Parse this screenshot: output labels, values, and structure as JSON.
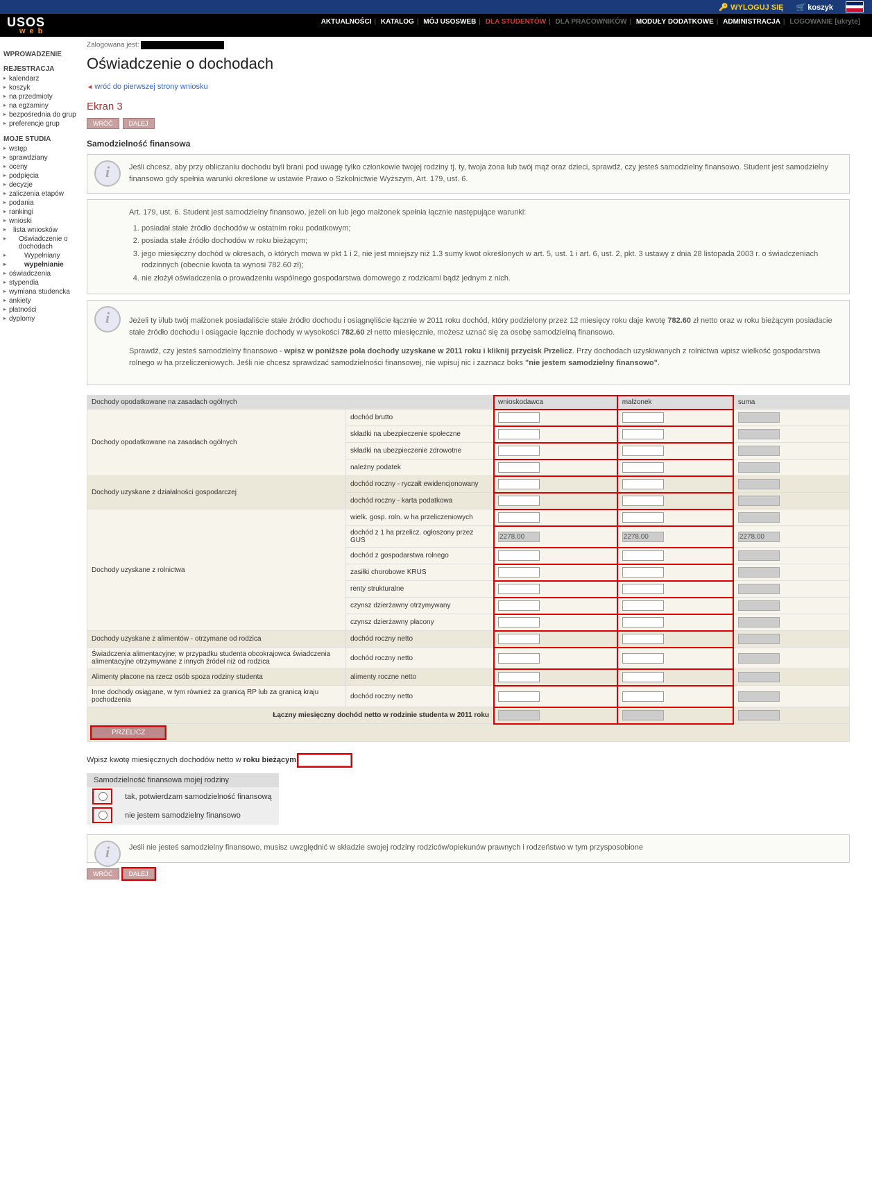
{
  "top": {
    "logout": "WYLOGUJ SIĘ",
    "cart": "koszyk"
  },
  "nav": {
    "items": [
      "AKTUALNOŚCI",
      "KATALOG",
      "MÓJ USOSWEB",
      "DLA STUDENTÓW",
      "DLA PRACOWNIKÓW",
      "MODUŁY DODATKOWE",
      "ADMINISTRACJA",
      "LOGOWANIE [ukryte]"
    ]
  },
  "logged_label": "Zalogowana jest:",
  "sidebar": {
    "s1": {
      "title": "WPROWADZENIE"
    },
    "s2": {
      "title": "REJESTRACJA",
      "items": [
        "kalendarz",
        "koszyk",
        "na przedmioty",
        "na egzaminy",
        "bezpośrednia do grup",
        "preferencje grup"
      ]
    },
    "s3": {
      "title": "MOJE STUDIA",
      "items": [
        "wstęp",
        "sprawdziany",
        "oceny",
        "podpięcia",
        "decyzje",
        "zaliczenia etapów",
        "podania",
        "rankingi",
        "wnioski"
      ],
      "sub": {
        "lista": "lista wniosków",
        "osw": "Oświadczenie o dochodach",
        "wyp": "Wypełniany",
        "wypel": "wypełnianie"
      },
      "rest": [
        "oświadczenia",
        "stypendia",
        "wymiana studencka",
        "ankiety",
        "płatności",
        "dyplomy"
      ]
    }
  },
  "page": {
    "title": "Oświadczenie o dochodach",
    "back": "wróć do pierwszej strony wniosku",
    "screen": "Ekran 3",
    "btn_back": "WRÓĆ",
    "btn_next": "DALEJ",
    "section": "Samodzielność finansowa"
  },
  "info1": "Jeśli chcesz, aby przy obliczaniu dochodu byli brani pod uwagę tylko członkowie twojej rodziny tj. ty, twoja żona lub twój mąż oraz dzieci, sprawdź, czy jesteś samodzielny finansowo. Student jest samodzielny finansowo gdy spełnia warunki określone w ustawie Prawo o Szkolnictwie Wyższym, Art. 179, ust. 6.",
  "info2": {
    "head": "Art. 179, ust. 6. Student jest samodzielny finansowo, jeżeli on lub jego małżonek spełnia łącznie następujące warunki:",
    "items": [
      "posiadał stałe źródło dochodów w ostatnim roku podatkowym;",
      "posiada stałe źródło dochodów w roku bieżącym;",
      "jego miesięczny dochód w okresach, o których mowa w pkt 1 i 2, nie jest mniejszy niż 1.3 sumy kwot określonych w art. 5, ust. 1 i art. 6, ust. 2, pkt. 3 ustawy z dnia 28 listopada 2003 r. o świadczeniach rodzinnych (obecnie kwota ta wynosi 782.60 zł);",
      "nie złożył oświadczenia o prowadzeniu wspólnego gospodarstwa domowego z rodzicami bądź jednym z nich."
    ]
  },
  "info3": {
    "p1a": "Jeżeli ty i/lub twój małżonek posiadaliście stałe źródło dochodu i osiągnęliście łącznie w 2011 roku dochód, który podzielony przez 12 miesięcy roku daje kwotę ",
    "b1": "782.60",
    "p1b": " zł netto oraz w roku bieżącym posiadacie stałe źródło dochodu i osiągacie łącznie dochody w wysokości ",
    "b2": "782.60",
    "p1c": " zł netto miesięcznie, możesz uznać się za osobę samodzielną finansowo.",
    "p2a": "Sprawdź, czy jesteś samodzielny finansowo - ",
    "b3": "wpisz w poniższe pola dochody uzyskane w 2011 roku i kliknij przycisk Przelicz",
    "p2b": ". Przy dochodach uzyskiwanych z rolnictwa wpisz wielkość gospodarstwa rolnego w ha przeliczeniowych. Jeśli nie chcesz sprawdzać samodzielności finansowej, nie wpisuj nic i zaznacz boks ",
    "b4": "\"nie jestem samodzielny finansowo\"",
    "p2c": "."
  },
  "table": {
    "head": {
      "c1": "Dochody opodatkowane na zasadach ogólnych",
      "c2": "",
      "w": "wnioskodawca",
      "m": "małżonek",
      "s": "suma"
    },
    "groups": [
      {
        "label": "Dochody opodatkowane na zasadach ogólnych",
        "rows": [
          {
            "l": "dochód brutto"
          },
          {
            "l": "składki na ubezpieczenie społeczne"
          },
          {
            "l": "składki na ubezpieczenie zdrowotne"
          },
          {
            "l": "należny podatek"
          }
        ],
        "cls": "w"
      },
      {
        "label": "Dochody uzyskane z działalności gospodarczej",
        "rows": [
          {
            "l": "dochód roczny - ryczałt ewidencjonowany"
          },
          {
            "l": "dochód roczny - karta podatkowa"
          }
        ],
        "cls": "g"
      },
      {
        "label": "Dochody uzyskane z rolnictwa",
        "rows": [
          {
            "l": "wielk. gosp. roln. w ha przeliczeniowych"
          },
          {
            "l": "dochód z 1 ha przelicz. ogłoszony przez GUS",
            "ro": true,
            "v": "2278.00"
          },
          {
            "l": "dochód z gospodarstwa rolnego"
          },
          {
            "l": "zasiłki chorobowe KRUS"
          },
          {
            "l": "renty strukturalne"
          },
          {
            "l": "czynsz dzierżawny otrzymywany"
          },
          {
            "l": "czynsz dzierżawny płacony"
          }
        ],
        "cls": "w"
      },
      {
        "label": "Dochody uzyskane z alimentów - otrzymane od rodzica",
        "rows": [
          {
            "l": "dochód roczny netto"
          }
        ],
        "cls": "g"
      },
      {
        "label": "Świadczenia alimentacyjne; w przypadku studenta obcokrajowca świadczenia alimentacyjne otrzymywane z innych źródeł niż od rodzica",
        "rows": [
          {
            "l": "dochód roczny netto"
          }
        ],
        "cls": "w"
      },
      {
        "label": "Alimenty płacone na rzecz osób spoza rodziny studenta",
        "rows": [
          {
            "l": "alimenty roczne netto"
          }
        ],
        "cls": "g"
      },
      {
        "label": "Inne dochody osiągane, w tym również za granicą RP lub za granicą kraju pochodzenia",
        "rows": [
          {
            "l": "dochód roczny netto"
          }
        ],
        "cls": "w"
      }
    ],
    "total": "Łączny miesięczny dochód netto w rodzinie studenta w 2011 roku",
    "przelicz": "PRZELICZ"
  },
  "current": {
    "pre": "Wpisz kwotę miesięcznych dochodów netto w ",
    "b": "roku bieżącym"
  },
  "self": {
    "title": "Samodzielność finansowa mojej rodziny",
    "opt1": "tak, potwierdzam samodzielność finansową",
    "opt2": "nie jestem samodzielny finansowo"
  },
  "info4": "Jeśli nie jesteś samodzielny finansowo, musisz uwzględnić w składzie swojej rodziny rodziców/opiekunów prawnych i rodzeństwo w tym przysposobione"
}
